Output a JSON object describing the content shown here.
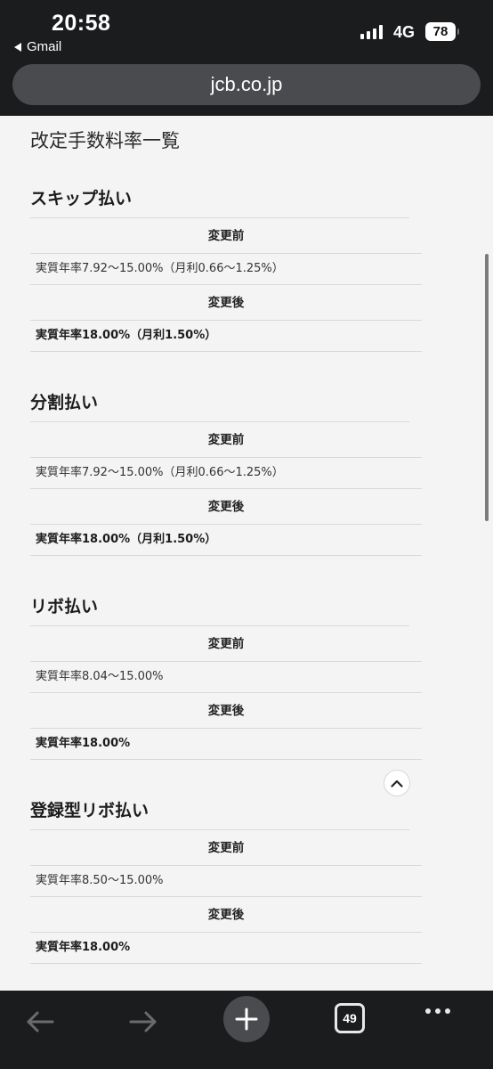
{
  "status_bar": {
    "time": "20:58",
    "back_app": "Gmail",
    "network": "4G",
    "battery": "78"
  },
  "browser": {
    "url": "jcb.co.jp",
    "tab_count": "49"
  },
  "page": {
    "title": "改定手数料率一覧",
    "sections": [
      {
        "title": "スキップ払い",
        "before_label": "変更前",
        "before_value": "実質年率7.92〜15.00%（月利0.66〜1.25%）",
        "after_label": "変更後",
        "after_value": "実質年率18.00%（月利1.50%）"
      },
      {
        "title": "分割払い",
        "before_label": "変更前",
        "before_value": "実質年率7.92〜15.00%（月利0.66〜1.25%）",
        "after_label": "変更後",
        "after_value": "実質年率18.00%（月利1.50%）"
      },
      {
        "title": "リボ払い",
        "before_label": "変更前",
        "before_value": "実質年率8.04〜15.00%",
        "after_label": "変更後",
        "after_value": "実質年率18.00%"
      },
      {
        "title": "登録型リボ払い",
        "before_label": "変更前",
        "before_value": "実質年率8.50〜15.00%",
        "after_label": "変更後",
        "after_value": "実質年率18.00%"
      }
    ]
  },
  "icons": {
    "back": "arrow-left-icon",
    "forward": "arrow-right-icon",
    "new_tab": "plus-icon",
    "tabs": "tabs-icon",
    "more": "more-icon",
    "scroll_top": "chevron-up-icon"
  }
}
